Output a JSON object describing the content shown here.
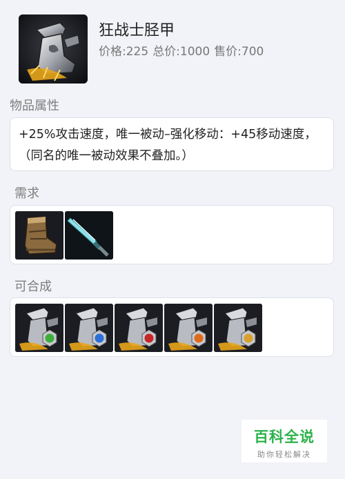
{
  "item": {
    "name": "狂战士胫甲",
    "price": "价格:225",
    "total_price": "总价:1000",
    "sell_price": "售价:700",
    "icon": "berserker-greaves-icon"
  },
  "attributes": {
    "title": "物品属性",
    "description": "+25%攻击速度，唯一被动–强化移动：+45移动速度，（同名的唯一被动效果不叠加。）"
  },
  "requirements": {
    "title": "需求",
    "items": [
      {
        "icon": "boots-of-speed-icon"
      },
      {
        "icon": "dagger-icon"
      }
    ]
  },
  "builds_into": {
    "title": "可合成",
    "items": [
      {
        "icon": "greaves-green-enchant-icon",
        "emblem_color": "#3cae3c"
      },
      {
        "icon": "greaves-blue-enchant-icon",
        "emblem_color": "#2c6fd8"
      },
      {
        "icon": "greaves-red-enchant-icon",
        "emblem_color": "#c62828"
      },
      {
        "icon": "greaves-orange-enchant-icon",
        "emblem_color": "#e06a1a"
      },
      {
        "icon": "greaves-gold-enchant-icon",
        "emblem_color": "#d8a02c"
      }
    ]
  },
  "watermark": {
    "title": "百科全说",
    "subtitle": "助你轻松解决"
  }
}
